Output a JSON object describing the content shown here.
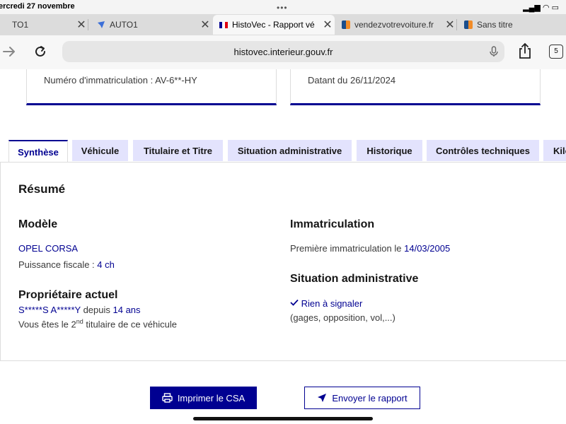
{
  "status": {
    "time": "ercredi 27 novembre",
    "dots": "•••",
    "signal": "▂▄▆ ◠ ▭"
  },
  "browser_tabs": [
    {
      "title": "TO1",
      "fav_color": "#999999"
    },
    {
      "title": "AUTO1",
      "fav_color": "#3b6fd8"
    },
    {
      "title": "HistoVec - Rapport vé",
      "fav_color": "#000091"
    },
    {
      "title": "vendezvotrevoiture.fr",
      "fav_color": "#f28c28"
    },
    {
      "title": "Sans titre",
      "fav_color": "#f28c28"
    }
  ],
  "toolbar": {
    "url": "histovec.interieur.gouv.fr",
    "tab_count": "5"
  },
  "cards": [
    {
      "text": "Numéro d'immatriculation : AV-6**-HY"
    },
    {
      "text": "Datant du 26/11/2024"
    }
  ],
  "nav_tabs": [
    "Synthèse",
    "Véhicule",
    "Titulaire et Titre",
    "Situation administrative",
    "Historique",
    "Contrôles techniques",
    "Kilo"
  ],
  "summary": {
    "title": "Résumé",
    "modele": {
      "heading": "Modèle",
      "name": "OPEL CORSA",
      "puissance_label": "Puissance fiscale :",
      "puissance_value": "4 ch"
    },
    "proprietaire": {
      "heading": "Propriétaire actuel",
      "name": "S*****S A*****Y",
      "depuis": "depuis",
      "duree": "14 ans",
      "rang_prefix": "Vous êtes le",
      "rang_num": "2",
      "rang_sup": "nd",
      "rang_suffix": "titulaire de ce véhicule"
    },
    "immatriculation": {
      "heading": "Immatriculation",
      "label": "Première immatriculation le",
      "date": "14/03/2005"
    },
    "situation": {
      "heading": "Situation administrative",
      "status": "Rien à signaler",
      "detail": "(gages, opposition, vol,...)"
    }
  },
  "actions": {
    "print": "Imprimer le CSA",
    "send": "Envoyer le rapport"
  },
  "colors": {
    "primary": "#000091",
    "tab_bg": "#e3e3fd"
  }
}
